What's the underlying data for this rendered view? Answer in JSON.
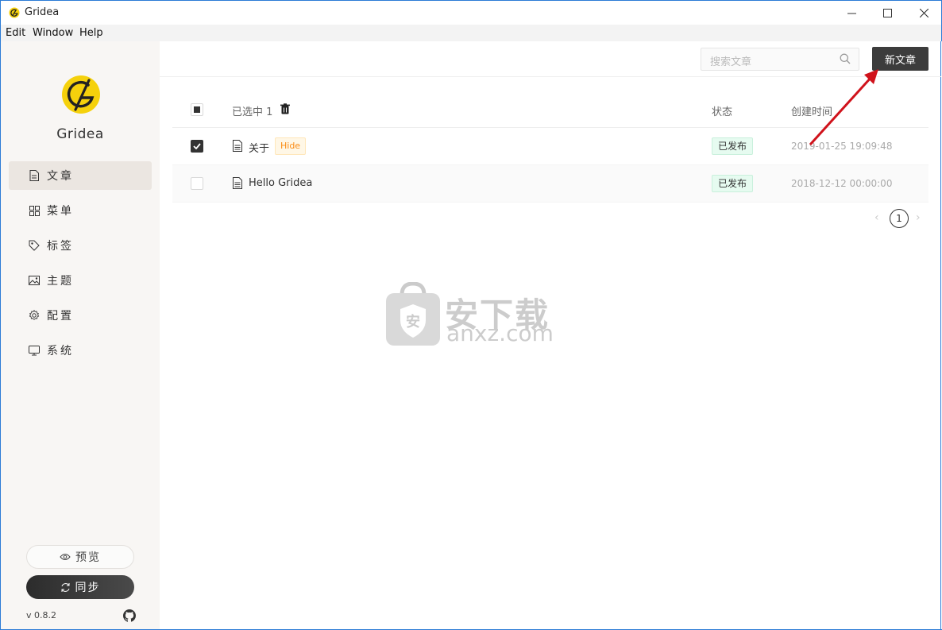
{
  "window": {
    "title": "Gridea",
    "min_glyph": "—",
    "max_glyph": "☐",
    "close_glyph": "✕"
  },
  "menu": [
    "Edit",
    "Window",
    "Help"
  ],
  "sidebar": {
    "brand": "Gridea",
    "items": [
      {
        "label": "文章",
        "icon": "document-icon",
        "active": true
      },
      {
        "label": "菜单",
        "icon": "grid-icon",
        "active": false
      },
      {
        "label": "标签",
        "icon": "tag-icon",
        "active": false
      },
      {
        "label": "主题",
        "icon": "image-icon",
        "active": false
      },
      {
        "label": "配置",
        "icon": "gear-icon",
        "active": false
      },
      {
        "label": "系统",
        "icon": "monitor-icon",
        "active": false
      }
    ],
    "preview_label": "预览",
    "sync_label": "同步",
    "version": "v 0.8.2"
  },
  "toolbar": {
    "search_placeholder": "搜索文章",
    "new_post_label": "新文章"
  },
  "table": {
    "selected_label": "已选中 1",
    "col_status": "状态",
    "col_created": "创建时间",
    "rows": [
      {
        "title": "关于",
        "tag": "Hide",
        "status": "已发布",
        "date": "2019-01-25 19:09:48",
        "checked": true
      },
      {
        "title": "Hello Gridea",
        "tag": "",
        "status": "已发布",
        "date": "2018-12-12 00:00:00",
        "checked": false
      }
    ]
  },
  "pagination": {
    "current": "1",
    "prev": "‹",
    "next": "›"
  },
  "watermark": {
    "line1": "安下载",
    "line2": "anxz.com"
  },
  "colors": {
    "accent": "#3c3c3c",
    "annotation_arrow": "#d0121b",
    "logo_yellow": "#f5d10c"
  }
}
